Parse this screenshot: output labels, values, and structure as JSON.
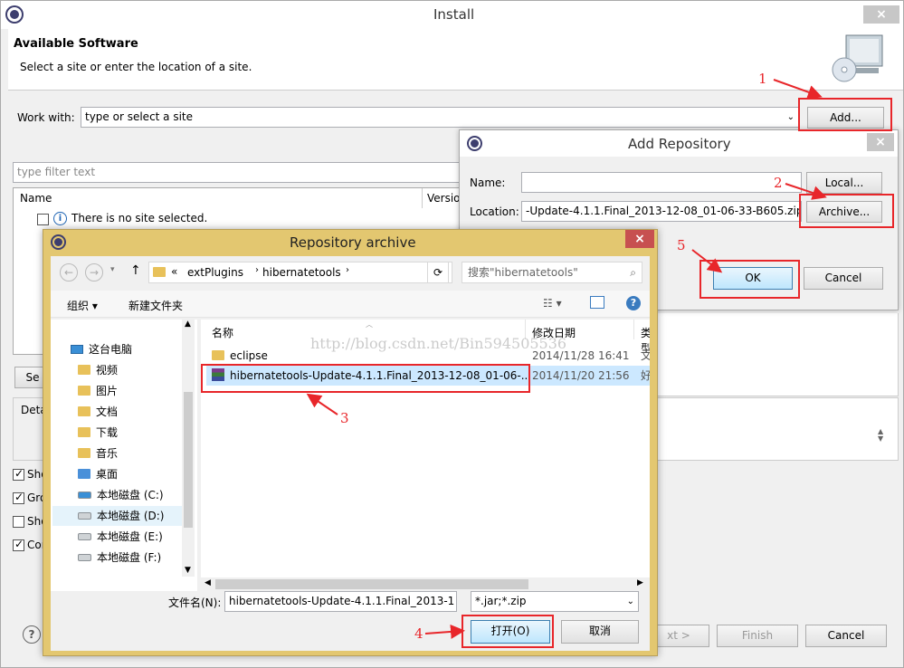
{
  "install": {
    "title": "Install",
    "header_title": "Available Software",
    "header_desc": "Select a site or enter the location of a site.",
    "work_with_label": "Work with:",
    "work_with_value": "type or select a site",
    "add_label": "Add...",
    "filter_placeholder": "type filter text",
    "col_name": "Name",
    "col_version": "Versio",
    "no_site": "There is no site selected.",
    "se_btn": "Se",
    "details_label": "Deta",
    "checks": [
      "Sho",
      "Gro",
      "Sho",
      "Cor"
    ],
    "next_label": "xt >",
    "finish_label": "Finish",
    "cancel_label": "Cancel"
  },
  "add_repo": {
    "title": "Add Repository",
    "name_label": "Name:",
    "name_value": "",
    "location_label": "Location:",
    "location_value": "-Update-4.1.1.Final_2013-12-08_01-06-33-B605.zip!/",
    "local_label": "Local...",
    "archive_label": "Archive...",
    "ok_label": "OK",
    "cancel_label": "Cancel"
  },
  "archive": {
    "title": "Repository archive",
    "breadcrumb": [
      "extPlugins",
      "hibernatetools"
    ],
    "breadcrumb_prefix": "«",
    "search_placeholder": "搜索\"hibernatetools\"",
    "organize_label": "组织 ▾",
    "new_folder_label": "新建文件夹",
    "nav": [
      {
        "label": "这台电脑",
        "type": "pc"
      },
      {
        "label": "视频",
        "type": "folder"
      },
      {
        "label": "图片",
        "type": "folder"
      },
      {
        "label": "文档",
        "type": "folder"
      },
      {
        "label": "下载",
        "type": "folder"
      },
      {
        "label": "音乐",
        "type": "folder"
      },
      {
        "label": "桌面",
        "type": "folder"
      },
      {
        "label": "本地磁盘 (C:)",
        "type": "drive"
      },
      {
        "label": "本地磁盘 (D:)",
        "type": "drive"
      },
      {
        "label": "本地磁盘 (E:)",
        "type": "drive"
      },
      {
        "label": "本地磁盘 (F:)",
        "type": "drive"
      }
    ],
    "col_name": "名称",
    "col_date": "修改日期",
    "col_type": "类型",
    "files": [
      {
        "name": "eclipse",
        "date": "2014/11/28 16:41",
        "type": "文件"
      },
      {
        "name": "hibernatetools-Update-4.1.1.Final_2013-12-08_01-06-...",
        "date": "2014/11/20 21:56",
        "type": "好压"
      }
    ],
    "filename_label": "文件名(N):",
    "filename_value": "hibernatetools-Update-4.1.1.Final_2013-1",
    "filter_value": "*.jar;*.zip",
    "open_label": "打开(O)",
    "cancel_label": "取消"
  },
  "watermark": "http://blog.csdn.net/Bin594505536",
  "annotations": [
    "1",
    "2",
    "3",
    "4",
    "5"
  ],
  "colors": {
    "annotation": "#e8262a",
    "dialog_frame": "#e3c770",
    "selection": "#cce8ff"
  }
}
